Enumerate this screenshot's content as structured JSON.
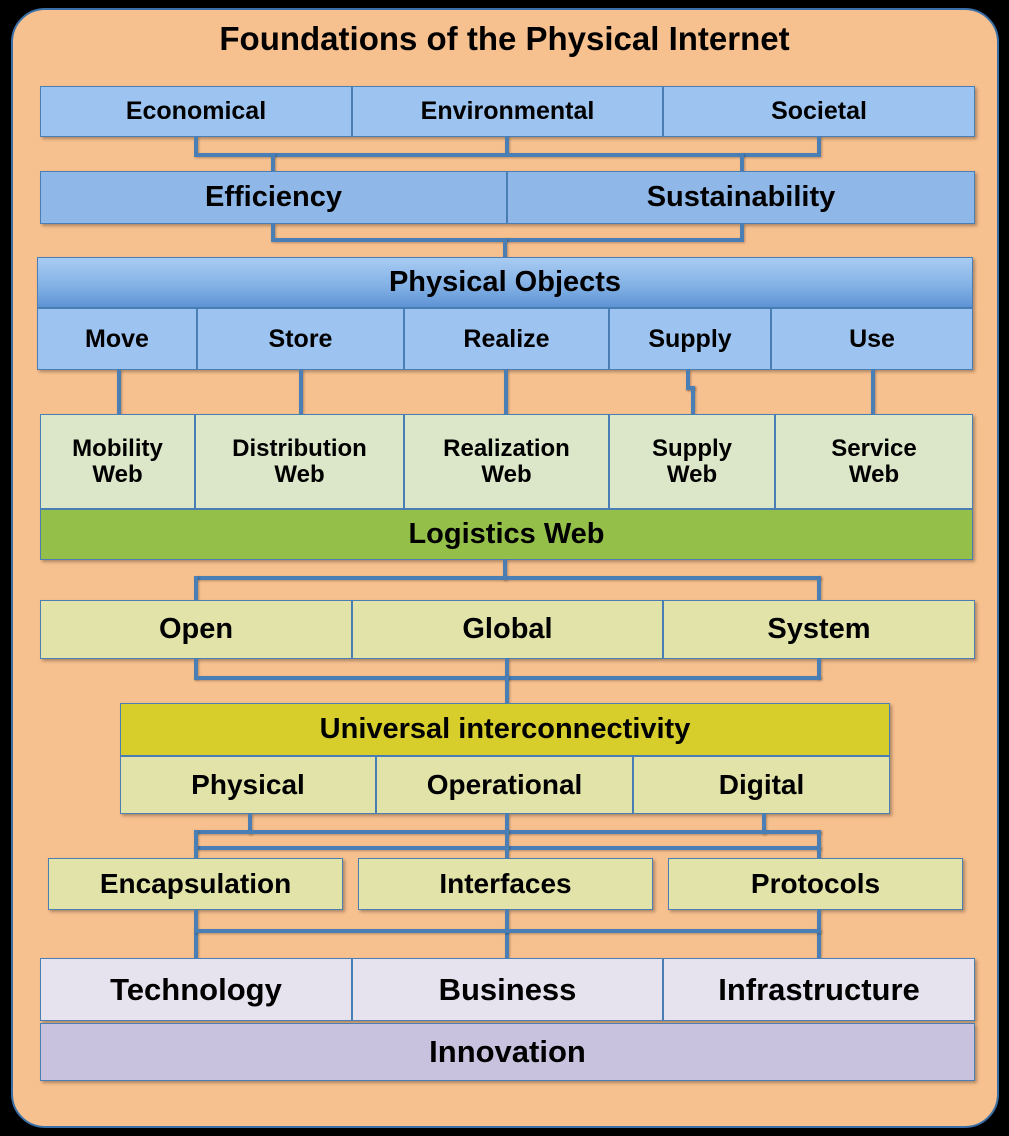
{
  "diagram": {
    "title": "Foundations of the Physical Internet",
    "type": "layered-pyramid-block-diagram",
    "palette": {
      "background": "#000000",
      "panel_fill": "#F7C08F",
      "panel_border": "#3A6FA8",
      "connector": "#4A7FB5",
      "blue_light": "#9DC3F0",
      "blue_medium": "#8FB8E8",
      "green_light": "#DCE6C8",
      "green_bright": "#94C04A",
      "khaki_light": "#E2E3A8",
      "khaki_dark": "#D7CE2B",
      "lavender_light": "#E6E2EE",
      "lavender_dark": "#C8C2DE"
    },
    "rows": [
      {
        "id": "drivers",
        "color": "blue_light",
        "cells": [
          {
            "label": "Economical"
          },
          {
            "label": "Environmental"
          },
          {
            "label": "Societal"
          }
        ]
      },
      {
        "id": "goals",
        "color": "blue_medium",
        "cells": [
          {
            "label": "Efficiency"
          },
          {
            "label": "Sustainability"
          }
        ]
      },
      {
        "id": "physical-objects-header",
        "color": "blue_gradient",
        "cells": [
          {
            "label": "Physical Objects"
          }
        ]
      },
      {
        "id": "object-actions",
        "color": "blue_light",
        "cells": [
          {
            "label": "Move"
          },
          {
            "label": "Store"
          },
          {
            "label": "Realize"
          },
          {
            "label": "Supply"
          },
          {
            "label": "Use"
          }
        ]
      },
      {
        "id": "webs",
        "color": "green_light",
        "cells": [
          {
            "line1": "Mobility",
            "line2": "Web"
          },
          {
            "line1": "Distribution",
            "line2": "Web"
          },
          {
            "line1": "Realization",
            "line2": "Web"
          },
          {
            "line1": "Supply",
            "line2": "Web"
          },
          {
            "line1": "Service",
            "line2": "Web"
          }
        ]
      },
      {
        "id": "logistics-web-footer",
        "color": "green_bright",
        "cells": [
          {
            "label": "Logistics Web"
          }
        ]
      },
      {
        "id": "system-properties",
        "color": "khaki_light",
        "cells": [
          {
            "label": "Open"
          },
          {
            "label": "Global"
          },
          {
            "label": "System"
          }
        ]
      },
      {
        "id": "universal-interconnectivity-header",
        "color": "khaki_dark",
        "cells": [
          {
            "label": "Universal interconnectivity"
          }
        ]
      },
      {
        "id": "interconnectivity-kinds",
        "color": "khaki_light",
        "cells": [
          {
            "label": "Physical"
          },
          {
            "label": "Operational"
          },
          {
            "label": "Digital"
          }
        ]
      },
      {
        "id": "mechanisms",
        "color": "khaki_light",
        "cells": [
          {
            "label": "Encapsulation"
          },
          {
            "label": "Interfaces"
          },
          {
            "label": "Protocols"
          }
        ]
      },
      {
        "id": "innovation-domains",
        "color": "lavender_light",
        "cells": [
          {
            "label": "Technology"
          },
          {
            "label": "Business"
          },
          {
            "label": "Infrastructure"
          }
        ]
      },
      {
        "id": "innovation-footer",
        "color": "lavender_dark",
        "cells": [
          {
            "label": "Innovation"
          }
        ]
      }
    ]
  }
}
